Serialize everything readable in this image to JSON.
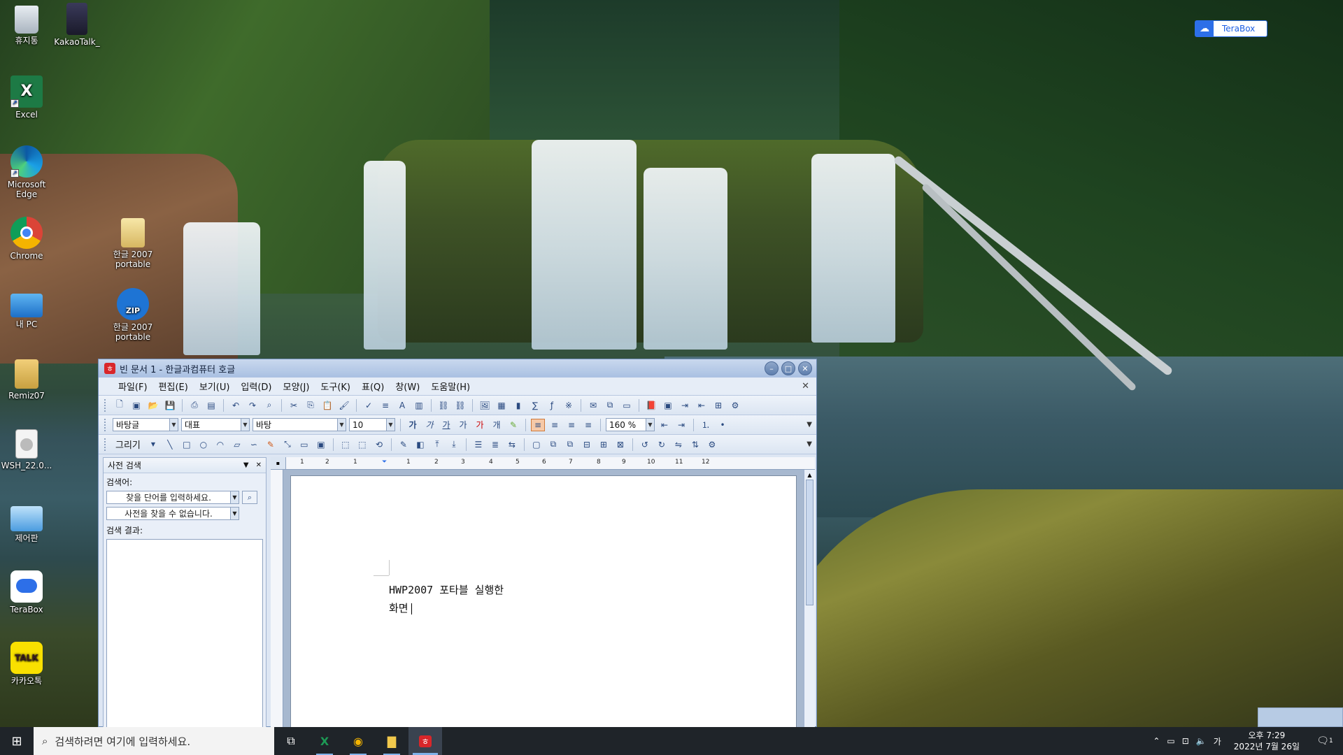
{
  "desktop": {
    "icons": [
      {
        "label": "휴지통",
        "icon": "recycle-bin-icon"
      },
      {
        "label": "KakaoTalk_",
        "icon": "kakaotalk-file-icon"
      },
      {
        "label": "Excel",
        "icon": "excel-icon"
      },
      {
        "label": "Microsoft Edge",
        "icon": "edge-icon"
      },
      {
        "label": "Chrome",
        "icon": "chrome-icon"
      },
      {
        "label": "한글 2007 portable",
        "icon": "folder-icon"
      },
      {
        "label": "내 PC",
        "icon": "computer-icon"
      },
      {
        "label": "한글 2007 portable",
        "icon": "zip-icon"
      },
      {
        "label": "Remiz07",
        "icon": "user-folder-icon"
      },
      {
        "label": "WSH_22.0...",
        "icon": "file-icon"
      },
      {
        "label": "제어판",
        "icon": "control-panel-icon"
      },
      {
        "label": "TeraBox",
        "icon": "terabox-icon"
      },
      {
        "label": "카카오톡",
        "icon": "kakaotalk-icon"
      }
    ],
    "terabox_badge": "TeraBox"
  },
  "window": {
    "title": "빈 문서 1 - 한글과컴퓨터 호글",
    "menus": [
      "파일(F)",
      "편집(E)",
      "보기(U)",
      "입력(D)",
      "모양(J)",
      "도구(K)",
      "표(Q)",
      "창(W)",
      "도움말(H)"
    ],
    "format": {
      "language": "바탕글",
      "style": "대표",
      "font": "바탕",
      "size": "10",
      "zoom": "160 %"
    },
    "draw_label": "그리기",
    "panel": {
      "title": "사전 검색",
      "search_label": "검색어:",
      "search_placeholder": "찾을 단어를 입력하세요.",
      "dictionary_status": "사전을 찾을 수 없습니다.",
      "results_label": "검색 결과:"
    },
    "ruler_ticks": [
      "1",
      "2",
      "1",
      "1",
      "2",
      "3",
      "4",
      "5",
      "6",
      "7",
      "8",
      "9",
      "10",
      "11",
      "12"
    ],
    "document": {
      "line1": "HWP2007 포타블 실행한",
      "line2": "화면"
    }
  },
  "taskbar": {
    "search_placeholder": "검색하려면 여기에 입력하세요.",
    "tray_ime": "가",
    "time": "오후 7:29",
    "date": "2022년 7월 26일",
    "notification_count": "1"
  }
}
